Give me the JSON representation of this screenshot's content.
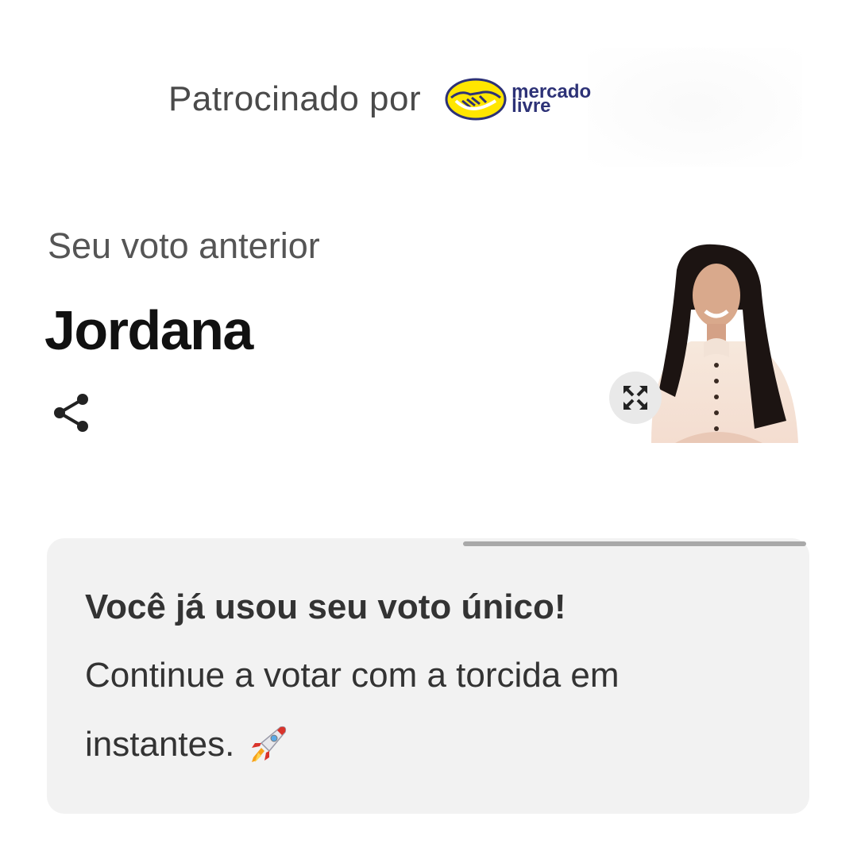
{
  "sponsor": {
    "label": "Patrocinado por",
    "logo_line1": "mercado",
    "logo_line2": "livre",
    "logo_color": "#2d3277",
    "logo_bg": "#ffe600"
  },
  "vote": {
    "previous_label": "Seu voto anterior",
    "candidate_name": "Jordana",
    "share_icon": "share-icon",
    "expand_icon": "expand-icon"
  },
  "notice": {
    "title": "Você já usou seu voto único!",
    "line1": "Continue a votar com a torcida em",
    "line2": "instantes.",
    "emoji": "rocket-icon",
    "progress": 0.45
  }
}
